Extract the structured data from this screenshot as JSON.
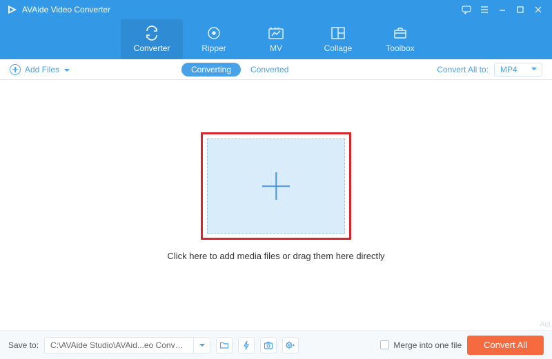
{
  "title": "AVAide Video Converter",
  "tabs": [
    {
      "label": "Converter"
    },
    {
      "label": "Ripper"
    },
    {
      "label": "MV"
    },
    {
      "label": "Collage"
    },
    {
      "label": "Toolbox"
    }
  ],
  "subbar": {
    "add_files": "Add Files",
    "seg_converting": "Converting",
    "seg_converted": "Converted",
    "convert_all_to": "Convert All to:",
    "format": "MP4"
  },
  "drop": {
    "hint": "Click here to add media files or drag them here directly"
  },
  "bottom": {
    "save_to_label": "Save to:",
    "save_path": "C:\\AVAide Studio\\AVAid...eo Converter\\Converted",
    "merge_label": "Merge into one file",
    "convert_all": "Convert All"
  },
  "watermark": "Act"
}
